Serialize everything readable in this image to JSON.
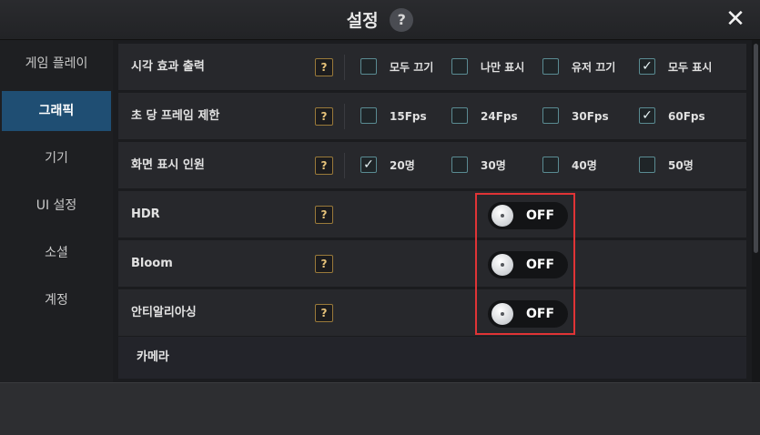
{
  "header": {
    "title": "설정",
    "help_icon": "?",
    "close_icon": "✕"
  },
  "sidebar": {
    "items": [
      {
        "label": "게임 플레이",
        "active": false
      },
      {
        "label": "그래픽",
        "active": true
      },
      {
        "label": "기기",
        "active": false
      },
      {
        "label": "UI 설정",
        "active": false
      },
      {
        "label": "소셜",
        "active": false
      },
      {
        "label": "계정",
        "active": false
      }
    ]
  },
  "settings": {
    "help_icon": "?",
    "check_mark": "✓",
    "rows": [
      {
        "label": "시각 효과 출력",
        "options": [
          {
            "label": "모두 끄기",
            "checked": false
          },
          {
            "label": "나만 표시",
            "checked": false
          },
          {
            "label": "유저 끄기",
            "checked": false
          },
          {
            "label": "모두 표시",
            "checked": true
          }
        ]
      },
      {
        "label": "초 당 프레임 제한",
        "options": [
          {
            "label": "15Fps",
            "checked": false
          },
          {
            "label": "24Fps",
            "checked": false
          },
          {
            "label": "30Fps",
            "checked": false
          },
          {
            "label": "60Fps",
            "checked": true
          }
        ]
      },
      {
        "label": "화면 표시 인원",
        "options": [
          {
            "label": "20명",
            "checked": true
          },
          {
            "label": "30명",
            "checked": false
          },
          {
            "label": "40명",
            "checked": false
          },
          {
            "label": "50명",
            "checked": false
          }
        ]
      },
      {
        "label": "HDR",
        "toggle": "OFF"
      },
      {
        "label": "Bloom",
        "toggle": "OFF"
      },
      {
        "label": "안티알리아싱",
        "toggle": "OFF"
      }
    ],
    "section": "카메라"
  },
  "colors": {
    "accent": "#1f4e73",
    "highlight": "#e03436",
    "checkbox_border": "#5a8b92",
    "help_border": "#9a7a3a"
  }
}
